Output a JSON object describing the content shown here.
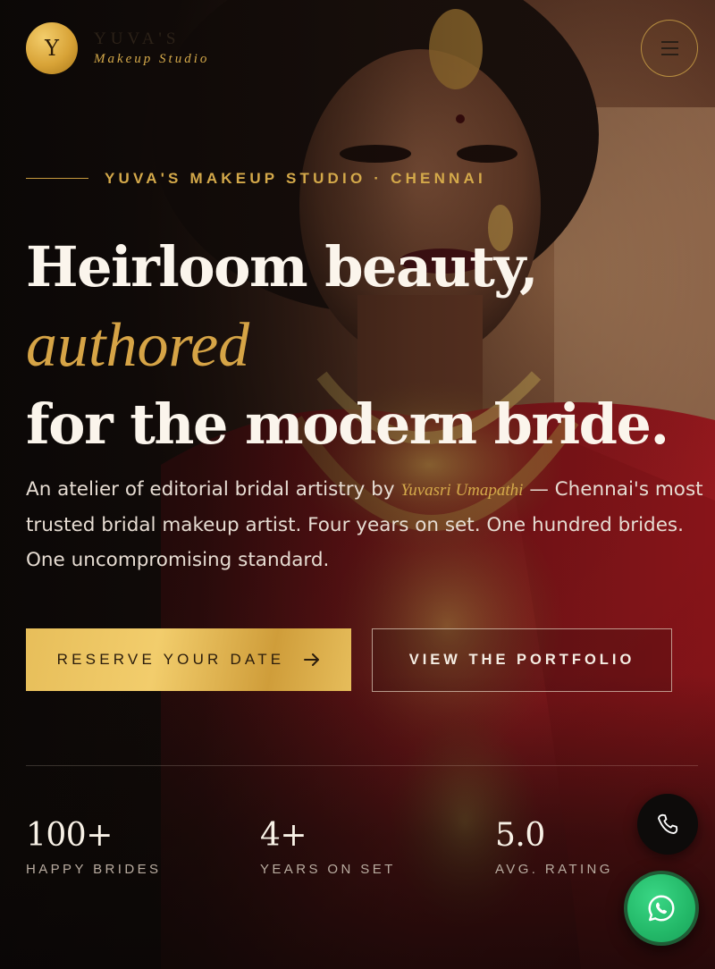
{
  "brand": {
    "monogram": "Y",
    "name": "YUVA'S",
    "subtitle": "Makeup Studio"
  },
  "header": {
    "menu_icon": "hamburger-menu-icon"
  },
  "hero": {
    "eyebrow": "YUVA'S MAKEUP STUDIO · CHENNAI",
    "headline_line1": "Heirloom beauty,",
    "headline_accent": "authored",
    "headline_line3": "for the modern bride.",
    "intro_before": "An atelier of editorial bridal artistry by",
    "intro_signature": "Yuvasri Umapathi",
    "intro_after": "— Chennai's most trusted bridal makeup artist. Four years on set. One hundred brides. One uncompromising standard."
  },
  "cta": {
    "primary_label": "RESERVE YOUR DATE",
    "primary_icon": "arrow-right-icon",
    "secondary_label": "VIEW THE PORTFOLIO"
  },
  "stats": [
    {
      "value": "100+",
      "label": "HAPPY BRIDES"
    },
    {
      "value": "4+",
      "label": "YEARS ON SET"
    },
    {
      "value": "5.0",
      "label": "AVG. RATING"
    }
  ],
  "floating": {
    "phone_icon": "phone-icon",
    "whatsapp_icon": "whatsapp-icon"
  },
  "colors": {
    "gold": "#d4a94a",
    "background": "#120d0b",
    "text": "#fbf5ec",
    "whatsapp": "#25c16f"
  }
}
